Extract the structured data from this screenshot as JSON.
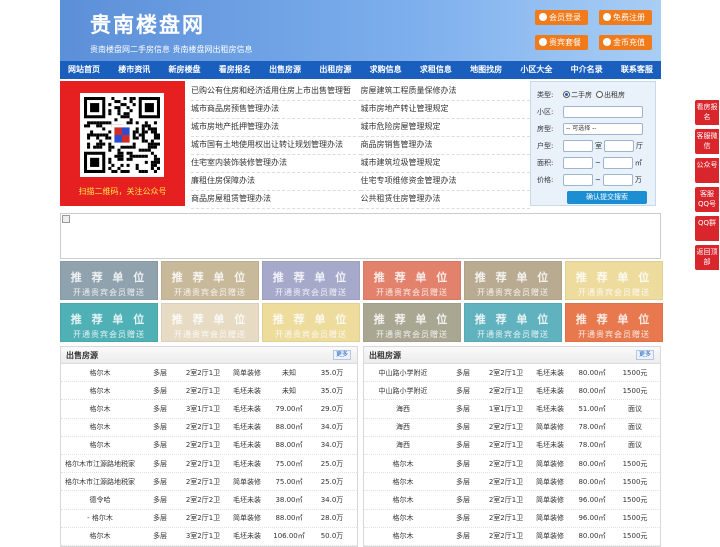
{
  "header": {
    "title": "贵南楼盘网",
    "subtitle": "贵南楼盘网二手房信息    贵南楼盘网出租房信息",
    "buttons": [
      {
        "label": "会员登录"
      },
      {
        "label": "免费注册"
      },
      {
        "label": "贵宾套餐"
      },
      {
        "label": "金币充值"
      }
    ]
  },
  "nav": [
    "网站首页",
    "楼市资讯",
    "新房楼盘",
    "看房报名",
    "出售房源",
    "出租房源",
    "求购信息",
    "求租信息",
    "地图找房",
    "小区大全",
    "中介名录",
    "联系客服"
  ],
  "qr": {
    "caption": "扫描二维码，关注公众号"
  },
  "links": {
    "left": [
      "已购公有住房和经济适用住房上市出售管理暂",
      "城市商品房预售管理办法",
      "城市房地产抵押管理办法",
      "城市国有土地使用权出让转让规划管理办法",
      "住宅室内装饰装修管理办法",
      "廉租住房保障办法",
      "商品房屋租赁管理办法"
    ],
    "right": [
      "房屋建筑工程质量保修办法",
      "城市房地产转让管理规定",
      "城市危险房屋管理规定",
      "商品房销售管理办法",
      "城市建筑垃圾管理规定",
      "住宅专项维修资金管理办法",
      "公共租赁住房管理办法"
    ]
  },
  "search": {
    "type_label": "类型:",
    "type_opt1": "二手房",
    "type_opt2": "出租房",
    "community_label": "小区:",
    "layout_label": "房型:",
    "layout_value": "-- 可选择 --",
    "rooms_label": "户型:",
    "room_unit": "室",
    "hall_unit": "厅",
    "area_label": "面积:",
    "area_unit": "㎡",
    "price_label": "价格:",
    "price_unit": "万",
    "submit": "确认提交搜索"
  },
  "ads": {
    "title": "推 荐 单 位",
    "sub": "开通贵宾会员赠送",
    "colors": [
      "#8fa2ae",
      "#c8b99a",
      "#a7a9cb",
      "#e2826c",
      "#b8ab92",
      "#eedc9e",
      "#4fb0b6",
      "#e7dbc4",
      "#eddc9c",
      "#a9a692",
      "#5fb2be",
      "#e8784e"
    ]
  },
  "sale": {
    "title": "出售房源",
    "more": "更多",
    "rows": [
      [
        "格尔木",
        "多层",
        "2室2厅1卫",
        "简单装修",
        "未知",
        "35.0万"
      ],
      [
        "格尔木",
        "多层",
        "2室2厅1卫",
        "毛坯未装",
        "未知",
        "35.0万"
      ],
      [
        "格尔木",
        "多层",
        "3室1厅1卫",
        "毛坯未装",
        "79.00㎡",
        "29.0万"
      ],
      [
        "格尔木",
        "多层",
        "2室2厅1卫",
        "毛坯未装",
        "88.00㎡",
        "34.0万"
      ],
      [
        "格尔木",
        "多层",
        "2室2厅1卫",
        "毛坯未装",
        "88.00㎡",
        "34.0万"
      ],
      [
        "格尔木市江源路地税家",
        "多层",
        "2室2厅1卫",
        "毛坯未装",
        "75.00㎡",
        "25.0万"
      ],
      [
        "格尔木市江源路地税家",
        "多层",
        "2室2厅1卫",
        "简单装修",
        "75.00㎡",
        "25.0万"
      ],
      [
        "德令哈",
        "多层",
        "2室2厅2卫",
        "毛坯未装",
        "38.00㎡",
        "34.0万"
      ],
      [
        "- 格尔木",
        "多层",
        "2室2厅1卫",
        "简单装修",
        "88.00㎡",
        "28.0万"
      ],
      [
        "格尔木",
        "多层",
        "3室2厅1卫",
        "毛坯未装",
        "106.00㎡",
        "50.0万"
      ]
    ]
  },
  "rent": {
    "title": "出租房源",
    "more": "更多",
    "rows": [
      [
        "中山路小学附近",
        "多层",
        "2室2厅1卫",
        "毛坯未装",
        "80.00㎡",
        "1500元"
      ],
      [
        "中山路小学附近",
        "多层",
        "2室2厅1卫",
        "毛坯未装",
        "80.00㎡",
        "1500元"
      ],
      [
        "海西",
        "多层",
        "1室1厅1卫",
        "毛坯未装",
        "51.00㎡",
        "面议"
      ],
      [
        "海西",
        "多层",
        "2室2厅1卫",
        "简单装修",
        "78.00㎡",
        "面议"
      ],
      [
        "海西",
        "多层",
        "2室2厅1卫",
        "毛坯未装",
        "78.00㎡",
        "面议"
      ],
      [
        "格尔木",
        "多层",
        "2室2厅1卫",
        "简单装修",
        "80.00㎡",
        "1500元"
      ],
      [
        "格尔木",
        "多层",
        "2室2厅1卫",
        "简单装修",
        "80.00㎡",
        "1500元"
      ],
      [
        "格尔木",
        "多层",
        "2室2厅1卫",
        "简单装修",
        "96.00㎡",
        "1500元"
      ],
      [
        "格尔木",
        "多层",
        "2室2厅1卫",
        "简单装修",
        "96.00㎡",
        "1500元"
      ],
      [
        "格尔木",
        "多层",
        "2室2厅1卫",
        "简单装修",
        "80.00㎡",
        "1500元"
      ]
    ]
  },
  "side": [
    "看房报名",
    "客服微信",
    "公众号",
    "客服QQ号",
    "QQ群",
    "返回顶部"
  ]
}
